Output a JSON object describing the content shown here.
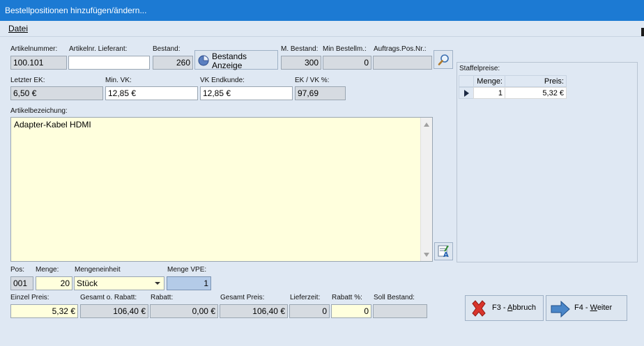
{
  "window": {
    "title": "Bestellpositionen hinzufügen/ändern..."
  },
  "menu": {
    "datei": "Datei"
  },
  "labels": {
    "artikelnummer": "Artikelnummer:",
    "artikelnr_lieferant": "Artikelnr. Lieferant:",
    "bestand": "Bestand:",
    "m_bestand": "M. Bestand:",
    "min_bestellm": "Min Bestellm.:",
    "auftrags_pos_nr": "Auftrags.Pos.Nr.:",
    "letzter_ek": "Letzter EK:",
    "min_vk": "Min. VK:",
    "vk_endkunde": "VK Endkunde:",
    "ek_vk": "EK / VK %:",
    "artikelbezeichnung": "Artikelbezeichung:",
    "pos": "Pos:",
    "menge": "Menge:",
    "mengeneinheit": "Mengeneinheit",
    "menge_vpe": "Menge VPE:",
    "einzel_preis": "Einzel Preis:",
    "gesamt_o_rabatt": "Gesamt o. Rabatt:",
    "rabatt": "Rabatt:",
    "gesamt_preis": "Gesamt Preis:",
    "lieferzeit": "Lieferzeit:",
    "rabatt_pct": "Rabatt %:",
    "soll_bestand": "Soll Bestand:",
    "staffelpreise": "Staffelpreise:"
  },
  "values": {
    "artikelnummer": "100.101",
    "artikelnr_lieferant": "",
    "bestand": "260",
    "m_bestand": "300",
    "min_bestellm": "0",
    "auftrags_pos_nr": "",
    "letzter_ek": "6,50 €",
    "min_vk": "12,85 €",
    "vk_endkunde": "12,85 €",
    "ek_vk": "97,69",
    "artikelbezeichnung": "Adapter-Kabel HDMI",
    "pos": "001",
    "menge": "20",
    "mengeneinheit": "Stück",
    "menge_vpe": "1",
    "einzel_preis": "5,32 €",
    "gesamt_o_rabatt": "106,40 €",
    "rabatt": "0,00 €",
    "gesamt_preis": "106,40 €",
    "lieferzeit": "0",
    "rabatt_pct": "0",
    "soll_bestand": ""
  },
  "bestands_button": {
    "line1": "Bestands",
    "line2": "Anzeige"
  },
  "staffelpreise": {
    "columns": [
      "Menge:",
      "Preis:"
    ],
    "rows": [
      {
        "menge": "1",
        "preis": "5,32 €"
      }
    ]
  },
  "buttons": {
    "abbruch_key": "F3 - ",
    "abbruch_mn": "A",
    "abbruch_rest": "bbruch",
    "weiter_key": "F4 - ",
    "weiter_mn": "W",
    "weiter_rest": "eiter"
  },
  "icons": {
    "search": "magnifier-icon",
    "edit_text": "spell-edit-icon",
    "cancel": "red-x-icon",
    "next": "blue-arrow-right-icon",
    "chart": "pie-chart-icon"
  },
  "colors": {
    "titlebar": "#1c7ad3",
    "background": "#dfe8f3",
    "readonly_field": "#d6dbe1",
    "yellow_field": "#ffffdd",
    "vpe_field": "#b4cbe8"
  }
}
